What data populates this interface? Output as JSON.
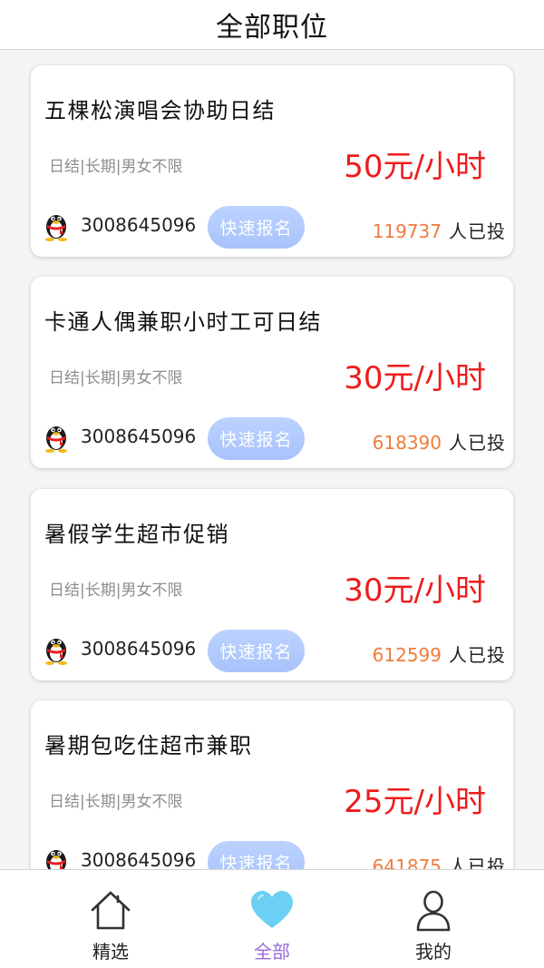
{
  "header": {
    "title": "全部职位"
  },
  "jobs": [
    {
      "title": "五棵松演唱会协助日结",
      "tags": "日结|长期|男女不限",
      "pay": "50元/小时",
      "qq": "3008645096",
      "apply_label": "快速报名",
      "applied_count": "119737",
      "applied_label": "人已投"
    },
    {
      "title": "卡通人偶兼职小时工可日结",
      "tags": "日结|长期|男女不限",
      "pay": "30元/小时",
      "qq": "3008645096",
      "apply_label": "快速报名",
      "applied_count": "618390",
      "applied_label": "人已投"
    },
    {
      "title": "暑假学生超市促销",
      "tags": "日结|长期|男女不限",
      "pay": "30元/小时",
      "qq": "3008645096",
      "apply_label": "快速报名",
      "applied_count": "612599",
      "applied_label": "人已投"
    },
    {
      "title": "暑期包吃住超市兼职",
      "tags": "日结|长期|男女不限",
      "pay": "25元/小时",
      "qq": "3008645096",
      "apply_label": "快速报名",
      "applied_count": "641875",
      "applied_label": "人已投"
    }
  ],
  "tabbar": {
    "tabs": [
      {
        "label": "精选",
        "icon": "home-icon"
      },
      {
        "label": "全部",
        "icon": "heart-icon"
      },
      {
        "label": "我的",
        "icon": "person-icon"
      }
    ],
    "active": "全部"
  },
  "colors": {
    "pay": "#ee1c1c",
    "applied_count": "#f07c3c",
    "apply_button": "#a8c2fb",
    "active_tab": "#9a6ad8",
    "heart": "#6cd0f4"
  }
}
